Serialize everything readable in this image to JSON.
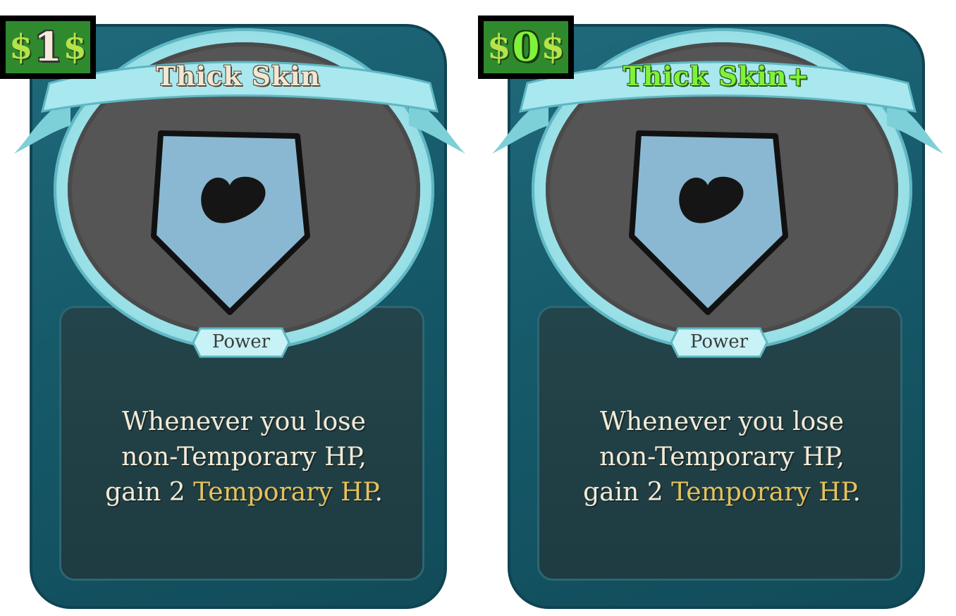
{
  "cards": [
    {
      "cost": "1",
      "cost_symbol": "$",
      "title": "Thick Skin",
      "upgraded": false,
      "type": "Power",
      "description": {
        "line1": "Whenever you lose",
        "line2": "non-Temporary HP,",
        "line3_prefix": "gain 2 ",
        "line3_keyword": "Temporary HP",
        "line3_suffix": "."
      },
      "art_icon": "shield-heart-icon"
    },
    {
      "cost": "0",
      "cost_symbol": "$",
      "title": "Thick Skin+",
      "upgraded": true,
      "type": "Power",
      "description": {
        "line1": "Whenever you lose",
        "line2": "non-Temporary HP,",
        "line3_prefix": "gain 2 ",
        "line3_keyword": "Temporary HP",
        "line3_suffix": "."
      },
      "art_icon": "shield-heart-icon"
    }
  ],
  "colors": {
    "card_frame": "#1f6a7c",
    "description_panel": "#23444a",
    "banner": "#9fe3ea",
    "title_normal": "#f1e8d4",
    "title_upgraded": "#7ff23a",
    "keyword": "#e6c25a",
    "cost_background": "#2f8a2e",
    "shield_fill": "#8ab8d2",
    "portrait_background": "#555555"
  }
}
